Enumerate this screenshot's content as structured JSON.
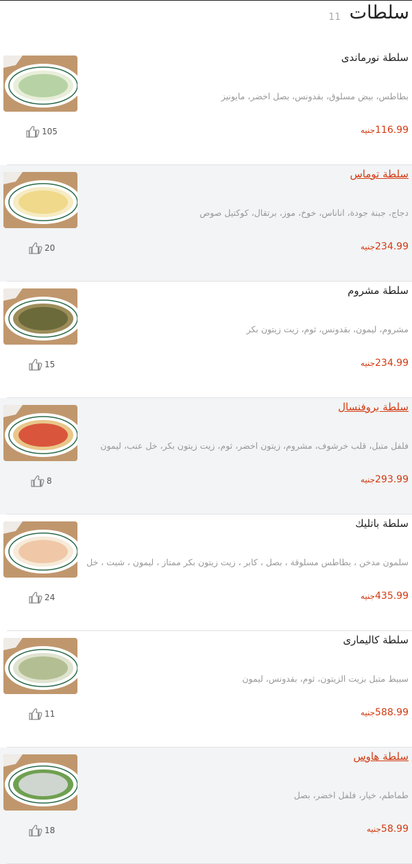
{
  "header": {
    "title": "سلطات",
    "count": "11"
  },
  "currency": "جنيه",
  "items": [
    {
      "name": "سلطة نورماندى",
      "desc": "بطاطس، بيض مسلوق، بقدونس، بصل اخضر، مايونيز",
      "price": "116.99",
      "likes": "105",
      "highlight": false,
      "alt": false
    },
    {
      "name": "سلطة توماس",
      "desc": "دجاج، جبنة جودة، اناناس، خوخ، موز، برتقال، كوكتيل صوص",
      "price": "234.99",
      "likes": "20",
      "highlight": true,
      "alt": true
    },
    {
      "name": "سلطة مشروم",
      "desc": "مشروم، ليمون، بقدونس، ثوم، زيت زيتون بكر",
      "price": "234.99",
      "likes": "15",
      "highlight": false,
      "alt": false
    },
    {
      "name": "سلطة بروفنسال",
      "desc": "فلفل متبل، قلب خرشوف، مشروم، زيتون اخضر، ثوم، زيت زيتون بكر، خل عنب، ليمون",
      "price": "293.99",
      "likes": "8",
      "highlight": true,
      "alt": true
    },
    {
      "name": "سلطة باتليك",
      "desc": "سلمون مدخن ، بطاطس مسلوقة ، بصل ، كابر ، زيت زيتون بكر ممتاز ، ليمون ، شبت ، خل",
      "price": "435.99",
      "likes": "24",
      "highlight": false,
      "alt": false
    },
    {
      "name": "سلطة كاليمارى",
      "desc": "سبيط متبل بزيت الزيتون، ثوم، بقدونس، ليمون",
      "price": "588.99",
      "likes": "11",
      "highlight": false,
      "alt": false
    },
    {
      "name": "سلطة هاوس",
      "desc": "طماطم، خيار، فلفل اخضر، بصل",
      "price": "58.99",
      "likes": "18",
      "highlight": true,
      "alt": true
    }
  ],
  "colors": {
    "accent": "#d33a12",
    "alt_bg": "#f2f4f5",
    "muted": "#999999"
  },
  "icons": {
    "like": "thumbs-up-icon"
  }
}
